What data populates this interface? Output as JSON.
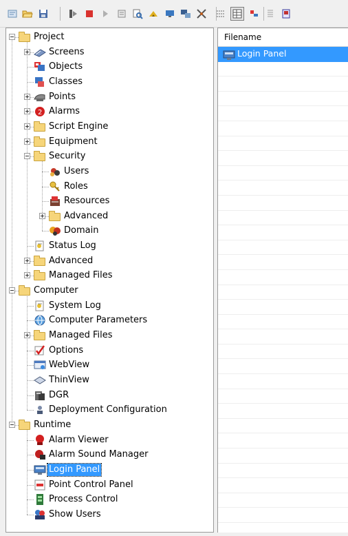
{
  "toolbar": {
    "buttons": [
      {
        "icon": "wizard-icon",
        "color": "#6a8fb5"
      },
      {
        "icon": "open-folder-icon",
        "color": "#e3b23c"
      },
      {
        "icon": "save-icon",
        "color": "#4a6da8"
      },
      {
        "icon": "run-icon",
        "color": "#555555"
      },
      {
        "icon": "stop-icon",
        "color": "#d9322e"
      },
      {
        "icon": "play-icon",
        "color": "#b0b0b0"
      },
      {
        "icon": "tools-icon",
        "color": "#8a8a8a"
      },
      {
        "icon": "find-icon",
        "color": "#3a6fb0"
      },
      {
        "icon": "connect-icon",
        "color": "#e0b020"
      },
      {
        "icon": "screen-icon",
        "color": "#3a78c0"
      },
      {
        "icon": "monitor-icon",
        "color": "#3a5f90"
      },
      {
        "icon": "network-icon",
        "color": "#555555"
      },
      {
        "icon": "grid-icon",
        "color": "#6a6a6a"
      },
      {
        "icon": "table-icon",
        "color": "#555555"
      },
      {
        "icon": "align-icon",
        "color": "#3a78c0"
      },
      {
        "icon": "list-icon",
        "color": "#a0a0a0"
      },
      {
        "icon": "exit-icon",
        "color": "#c03030"
      }
    ]
  },
  "tree": {
    "nodes": [
      {
        "label": "Project",
        "icon": "folder-icon",
        "level": 0,
        "expander": "minus"
      },
      {
        "label": "Screens",
        "icon": "screens-icon",
        "level": 1,
        "expander": "plus"
      },
      {
        "label": "Objects",
        "icon": "objects-icon",
        "level": 1,
        "expander": ""
      },
      {
        "label": "Classes",
        "icon": "classes-icon",
        "level": 1,
        "expander": ""
      },
      {
        "label": "Points",
        "icon": "points-icon",
        "level": 1,
        "expander": "plus"
      },
      {
        "label": "Alarms",
        "icon": "alarms-icon",
        "level": 1,
        "expander": "plus"
      },
      {
        "label": "Script Engine",
        "icon": "folder-icon",
        "level": 1,
        "expander": "plus"
      },
      {
        "label": "Equipment",
        "icon": "folder-icon",
        "level": 1,
        "expander": "plus"
      },
      {
        "label": "Security",
        "icon": "folder-icon",
        "level": 1,
        "expander": "minus"
      },
      {
        "label": "Users",
        "icon": "users-icon",
        "level": 2,
        "expander": ""
      },
      {
        "label": "Roles",
        "icon": "roles-icon",
        "level": 2,
        "expander": ""
      },
      {
        "label": "Resources",
        "icon": "resources-icon",
        "level": 2,
        "expander": ""
      },
      {
        "label": "Advanced",
        "icon": "folder-icon",
        "level": 2,
        "expander": "plus"
      },
      {
        "label": "Domain",
        "icon": "domain-icon",
        "level": 2,
        "expander": ""
      },
      {
        "label": "Status Log",
        "icon": "log-icon",
        "level": 1,
        "expander": ""
      },
      {
        "label": "Advanced",
        "icon": "folder-icon",
        "level": 1,
        "expander": "plus"
      },
      {
        "label": "Managed Files",
        "icon": "folder-icon",
        "level": 1,
        "expander": "plus"
      },
      {
        "label": "Computer",
        "icon": "folder-icon",
        "level": 0,
        "expander": "minus"
      },
      {
        "label": "System Log",
        "icon": "log-icon",
        "level": 1,
        "expander": ""
      },
      {
        "label": "Computer Parameters",
        "icon": "globe-icon",
        "level": 1,
        "expander": ""
      },
      {
        "label": "Managed Files",
        "icon": "folder-icon",
        "level": 1,
        "expander": "plus"
      },
      {
        "label": "Options",
        "icon": "options-icon",
        "level": 1,
        "expander": ""
      },
      {
        "label": "WebView",
        "icon": "webview-icon",
        "level": 1,
        "expander": ""
      },
      {
        "label": "ThinView",
        "icon": "thinview-icon",
        "level": 1,
        "expander": ""
      },
      {
        "label": "DGR",
        "icon": "dgr-icon",
        "level": 1,
        "expander": ""
      },
      {
        "label": "Deployment Configuration",
        "icon": "deployment-icon",
        "level": 1,
        "expander": ""
      },
      {
        "label": "Runtime",
        "icon": "folder-icon",
        "level": 0,
        "expander": "minus"
      },
      {
        "label": "Alarm Viewer",
        "icon": "alarm-viewer-icon",
        "level": 1,
        "expander": ""
      },
      {
        "label": "Alarm Sound Manager",
        "icon": "alarm-sound-icon",
        "level": 1,
        "expander": ""
      },
      {
        "label": "Login Panel",
        "icon": "login-panel-icon",
        "level": 1,
        "expander": "",
        "selected": true
      },
      {
        "label": "Point Control Panel",
        "icon": "point-control-icon",
        "level": 1,
        "expander": ""
      },
      {
        "label": "Process Control",
        "icon": "process-control-icon",
        "level": 1,
        "expander": ""
      },
      {
        "label": "Show Users",
        "icon": "show-users-icon",
        "level": 1,
        "expander": ""
      }
    ]
  },
  "list": {
    "header": "Filename",
    "items": [
      {
        "label": "Login Panel",
        "icon": "login-panel-icon",
        "selected": true
      }
    ],
    "accent": "#3399ff"
  }
}
